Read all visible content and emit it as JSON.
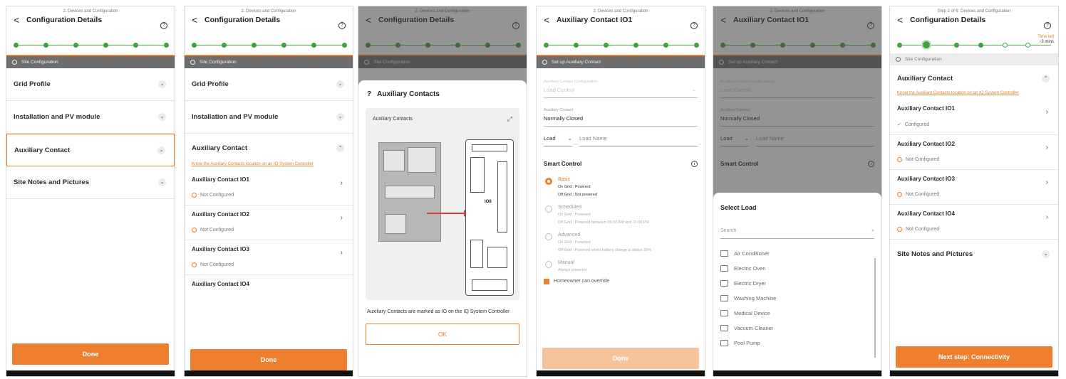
{
  "common": {
    "step_label": "2. Devices and Configuration",
    "step_label_long": "Step 2 of 6: Devices and Configuration",
    "help_glyph": "?",
    "back_glyph": "<",
    "site_config": "Site Configuration",
    "setup_aux": "Set up Auxiliary Contact",
    "done": "Done",
    "title_config": "Configuration Details",
    "title_aux": "Auxiliary Contact IO1",
    "know_link": "Know the Auxiliary Contacts location on an IQ System Controller",
    "not_configured": "Not Configured",
    "configured": "Configured"
  },
  "screen1": {
    "items": [
      "Grid Profile",
      "Installation and PV module",
      "Auxiliary Contact",
      "Site Notes and Pictures"
    ]
  },
  "screen2": {
    "items": [
      "Grid Profile",
      "Installation and PV module",
      "Auxiliary Contact"
    ],
    "aux": [
      "Auxiliary Contact IO1",
      "Auxiliary Contact IO2",
      "Auxiliary Contact IO3",
      "Auxiliary Contact IO4"
    ]
  },
  "screen3": {
    "modal_title": "Auxiliary Contacts",
    "card_title": "Auxiliary Contacts",
    "io_label": "IO8",
    "desc": "Auxiliary Contacts are marked as IO on the IQ System Controller",
    "ok": "OK"
  },
  "screen4": {
    "config_label": "Auxiliary Contact Configuration",
    "config_value": "Load Control",
    "contact_label": "Auxiliary Contact",
    "contact_value": "Normally Closed",
    "load": "Load",
    "load_name": "Load Name",
    "smart_control": "Smart Control",
    "options": [
      {
        "title": "Basic",
        "l1": "On Grid : Powered",
        "l2": "Off Grid : Not powered"
      },
      {
        "title": "Scheduled",
        "l1": "On Grid : Powered",
        "l2": "Off Grid : Powered between 06:00 AM and 11:00 PM"
      },
      {
        "title": "Advanced",
        "l1": "On Grid : Powered",
        "l2": "Off Grid : Powered when battery charge is above 30%"
      },
      {
        "title": "Manual",
        "l1": "Always powered",
        "l2": ""
      }
    ],
    "homeowner": "Homeowner can override"
  },
  "screen5": {
    "sheet_title": "Select Load",
    "search_placeholder": "Search",
    "loads": [
      "Air Conditioner",
      "Electric Oven",
      "Electric Dryer",
      "Washing Machine",
      "Medical Device",
      "Vacuum Cleaner",
      "Pool Pump"
    ]
  },
  "screen6": {
    "time_left": "Time left",
    "time_value": "~3 mins",
    "aux_title": "Auxiliary Contact",
    "aux": [
      "Auxiliary Contact IO1",
      "Auxiliary Contact IO2",
      "Auxiliary Contact IO3",
      "Auxiliary Contact IO4"
    ],
    "site_notes": "Site Notes and Pictures",
    "next": "Next step: Connectivity"
  },
  "colors": {
    "accent": "#ee7f2e",
    "green": "#3ea33f"
  }
}
